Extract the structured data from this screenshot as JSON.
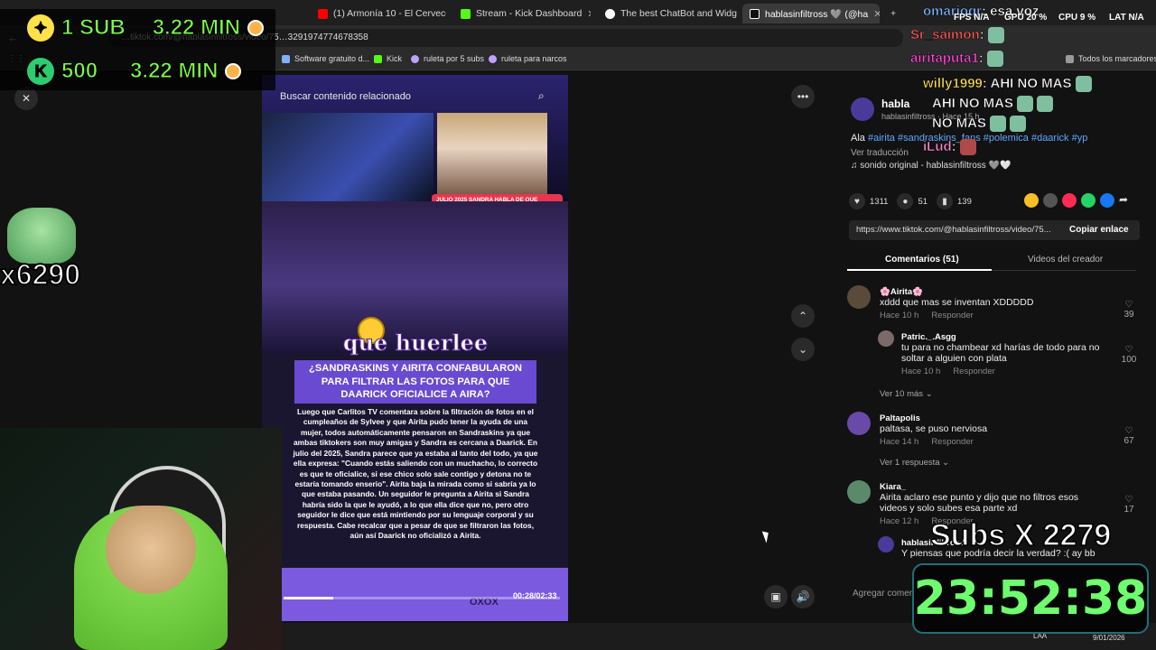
{
  "browser": {
    "tabs": [
      {
        "label": "(1) Armonía 10 - El Cervecero (",
        "color": "#ff0000"
      },
      {
        "label": "Stream - Kick Dashboard",
        "color": "#53fc18"
      },
      {
        "label": "The best ChatBot and Widgets",
        "color": "#ffffff"
      },
      {
        "label": "hablasinfiltross 🩶 (@ha",
        "color": "#111111"
      }
    ],
    "new_tab": "+",
    "url": "…tiktok.com/@hablasinfiltross/video/75…3291974774678358",
    "bookmarks": [
      {
        "label": "Software gratuito d...",
        "color": "#7fb0ff"
      },
      {
        "label": "Kick",
        "color": "#53fc18"
      },
      {
        "label": "ruleta por 5 subs",
        "color": "#c0a0ff"
      },
      {
        "label": "ruleta para narcos",
        "color": "#c0a0ff"
      },
      {
        "label": "Todos los marcadores",
        "color": "#999999"
      }
    ]
  },
  "video": {
    "search_placeholder": "Buscar contenido relacionado",
    "pink_caption": "JULIO 2025 SANDRA HABLA DE QUE CUANDO UN HOMBRE QUIERE A ALGUIEN LA TIENE QUE OFICIALIZAR.",
    "brand_text": "que huerlee",
    "headline": "¿SANDRASKINS Y AIRITA CONFABULARON PARA FILTRAR LAS FOTOS PARA QUE DAARICK OFICIALICE A AIRA?",
    "body": "Luego que Carlitos TV comentara sobre la filtración de fotos en el cumpleaños de Sylvee y que Airita pudo tener la ayuda de una mujer, todos automáticamente pensaron en Sandraskins ya que ambas tiktokers son muy amigas y Sandra es cercana a Daarick. En julio del 2025, Sandra parece que ya estaba al tanto del todo, ya que ella expresa: \"Cuando estás saliendo con un muchacho, lo correcto es que te oficialice, si ese chico solo sale contigo y detona no te estaría tomando enserio\". Airita baja la mirada como si sabría ya lo que estaba pasando. Un seguidor le pregunta a Airita si Sandra habría sido la que le ayudó, a lo que ella dice que no, pero otro seguidor le dice que está mintiendo por su lenguaje corporal y su respuesta. Cabe recalcar que a pesar de que se filtraron las fotos, aún así Daarick no oficializó a Airita.",
    "time": "00:28/02:33",
    "progress": 0.18,
    "bottom_text": "OXOX"
  },
  "post": {
    "username": "habla",
    "handle": "hablasinfiltross · Hace 15 h",
    "desc_prefix": "Ala",
    "tags": "#airita #sandraskins_fans #polemica #daarick #yp",
    "translate": "Ver traducción",
    "sound": "♫ sonido original - hablasinfiltross 🩶🤍",
    "likes": "1311",
    "comments": "51",
    "saves": "139",
    "share_colors": [
      "#f6c026",
      "#555555",
      "#fe2c55",
      "#25d366",
      "#1877f2"
    ],
    "link": "https://www.tiktok.com/@hablasinfiltross/video/75...",
    "copy": "Copiar enlace",
    "tab_comments": "Comentarios (51)",
    "tab_videos": "Videos del creador",
    "add_comment": "Agregar comentario..."
  },
  "comments": [
    {
      "who": "🌸Airita🌸",
      "text": "xddd que mas se inventan XDDDDD",
      "time": "Hace 10 h",
      "reply": "Responder",
      "likes": "39"
    },
    {
      "who": "Patric._.Asgg",
      "text": "tu para no chambear xd harías de todo para no soltar a alguien con plata",
      "time": "Hace 10 h",
      "reply": "Responder",
      "likes": "100"
    },
    {
      "who": "Paltapolis",
      "text": "paltasa, se puso nerviosa",
      "time": "Hace 14 h",
      "reply": "Responder",
      "likes": "67"
    },
    {
      "who": "Kiara_",
      "text": "Airita aclaro ese punto y dijo que no filtros esos videos y solo subes esa parte xd",
      "time": "Hace 12 h",
      "reply": "Responder",
      "likes": "17"
    },
    {
      "who": "hablasinfiltross",
      "text": "Y piensas que podría decir la verdad? :( ay bb",
      "time": "",
      "reply": "",
      "likes": ""
    }
  ],
  "more_replies_1": "Ver 10 más",
  "more_replies_2": "Ver 1 respuesta",
  "overlay": {
    "sub_goal": "1 SUB",
    "sub_time": "3.22 MIN",
    "kick_goal": "500",
    "kick_time": "3.22 MIN",
    "multiplier": "x6290",
    "subs_x": "Subs X 2279",
    "timer": "23:52:38",
    "chat": [
      {
        "name": "omarioqr",
        "msg": ": esa voz",
        "color": "#7fb6ff"
      },
      {
        "name": "Sr_saimon",
        "msg": ":",
        "color": "#ff5a5a"
      },
      {
        "name": "airitaputa1",
        "msg": ":",
        "color": "#ff4ad8"
      },
      {
        "name": "willy1999",
        "msg": ": AHI NO MAS",
        "color": "#ffe14a"
      },
      {
        "name": "",
        "msg": "AHI NO MAS",
        "color": "#ffffff"
      },
      {
        "name": "",
        "msg": "NO MAS",
        "color": "#ffffff"
      },
      {
        "name": "iLud",
        "msg": ":",
        "color": "#ff8ad8"
      }
    ],
    "perf": {
      "fps": "FPS N/A",
      "gpu": "GPU 20 %",
      "cpu": "CPU 9 %",
      "lat": "LAT N/A"
    }
  },
  "taskbar": {
    "lang": "LAA",
    "date": "9/01/2026"
  }
}
